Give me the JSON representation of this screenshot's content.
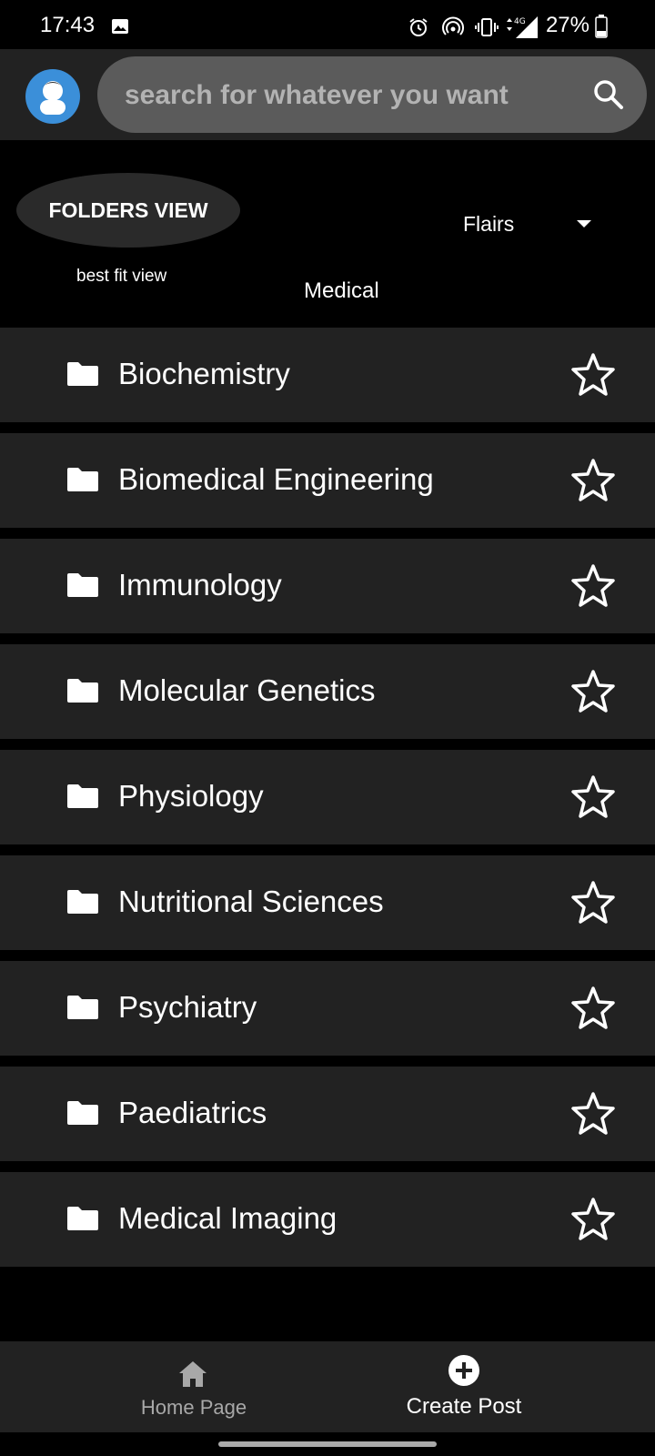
{
  "status_bar": {
    "time": "17:43",
    "network": "4G",
    "battery": "27%"
  },
  "search": {
    "placeholder": "search for whatever you want"
  },
  "view_toggle": {
    "folders_view": "FOLDERS VIEW",
    "best_fit_view": "best fit view"
  },
  "flairs": {
    "label": "Flairs",
    "selected": "Medical"
  },
  "folders": [
    {
      "name": "Biochemistry"
    },
    {
      "name": "Biomedical Engineering"
    },
    {
      "name": "Immunology"
    },
    {
      "name": "Molecular Genetics"
    },
    {
      "name": "Physiology"
    },
    {
      "name": "Nutritional Sciences"
    },
    {
      "name": "Psychiatry"
    },
    {
      "name": "Paediatrics"
    },
    {
      "name": "Medical Imaging"
    }
  ],
  "bottom_nav": {
    "home_label": "Home Page",
    "create_label": "Create Post"
  },
  "colors": {
    "background": "#000000",
    "surface": "#222222",
    "search_bg": "#5b5b5b",
    "avatar_blue": "#3b8fd9"
  },
  "icons": [
    "image-icon",
    "alarm-icon",
    "hotspot-icon",
    "vibrate-icon",
    "signal-icon",
    "battery-icon",
    "avatar-icon",
    "search-icon",
    "dropdown-arrow-icon",
    "folder-icon",
    "star-icon",
    "home-icon",
    "add-circle-icon"
  ]
}
